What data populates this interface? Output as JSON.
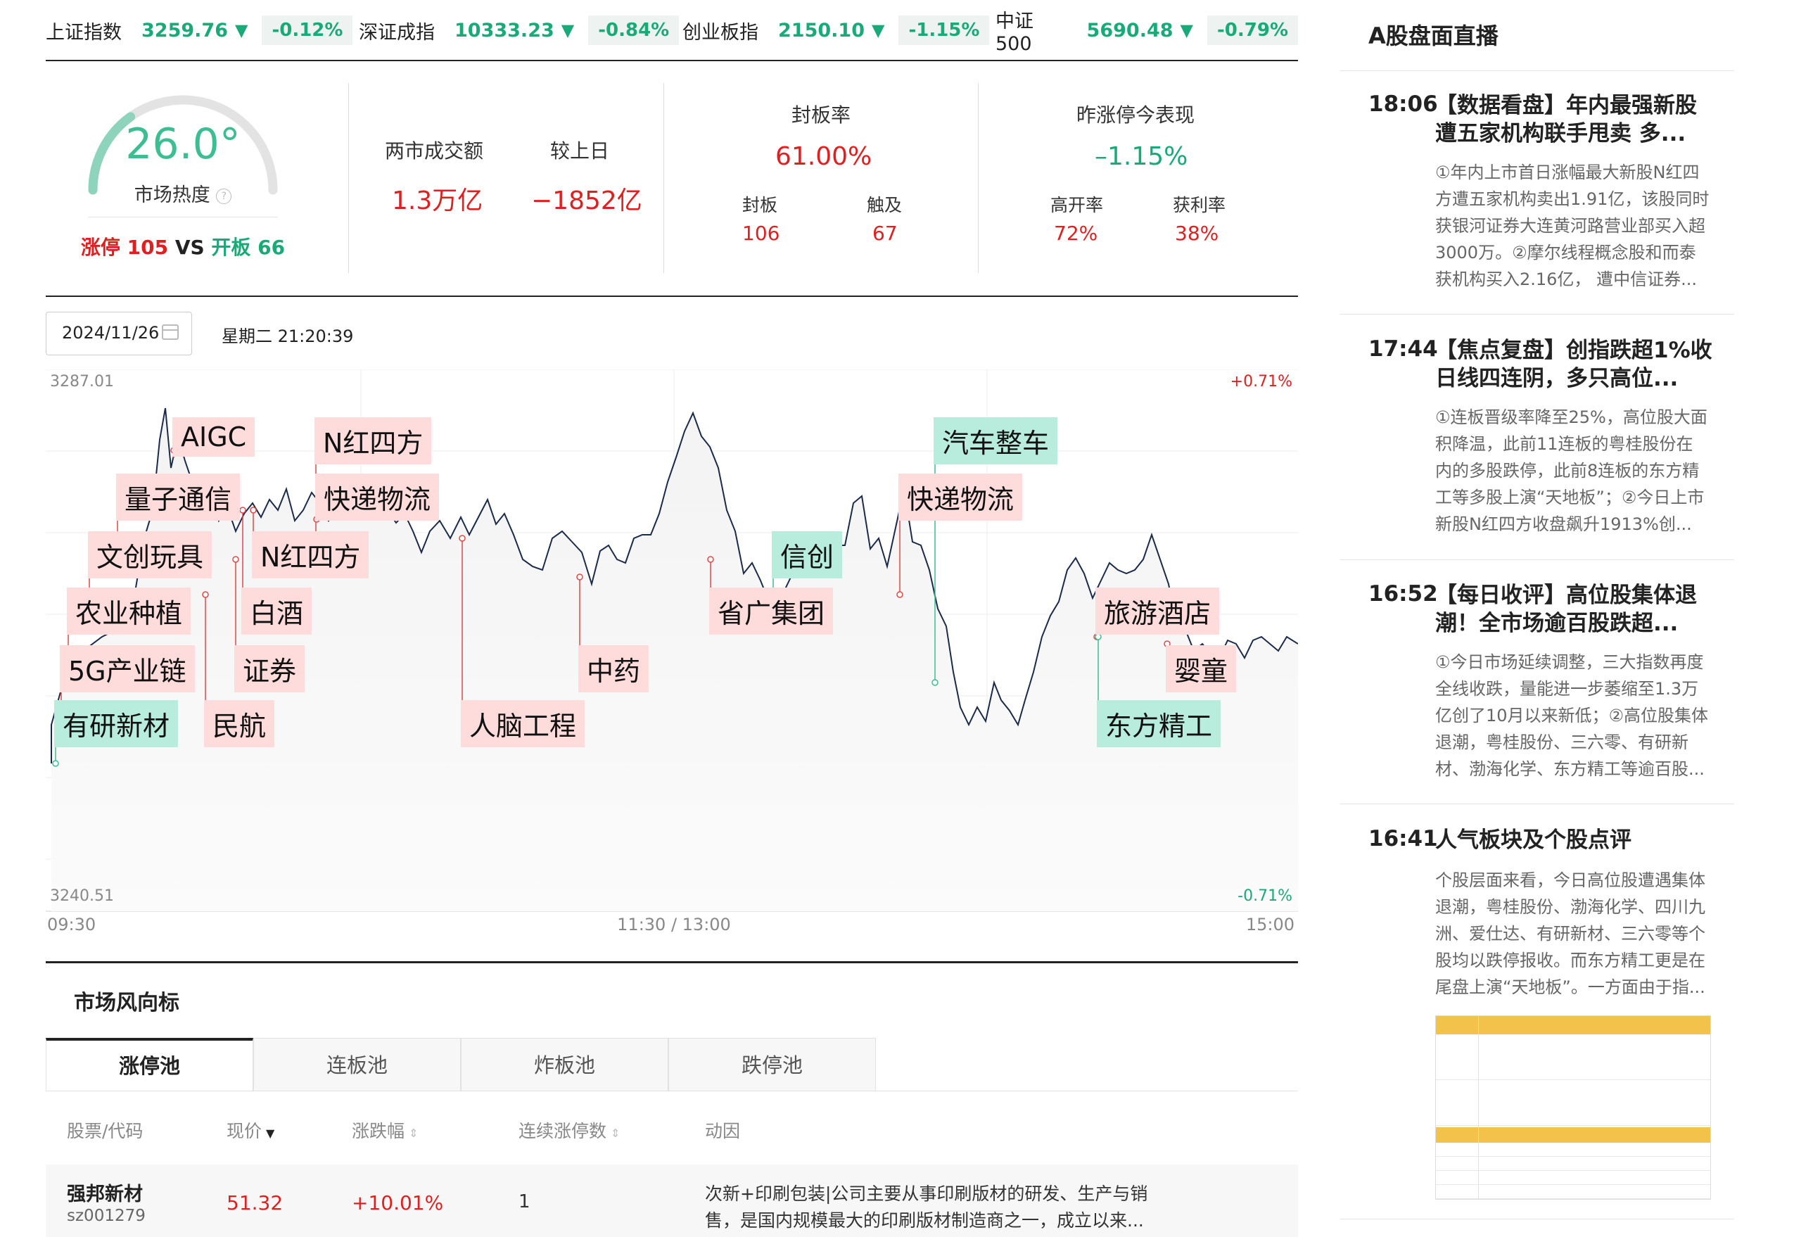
{
  "indices": [
    {
      "name": "上证指数",
      "value": "3259.76",
      "change": "-0.12%"
    },
    {
      "name": "深证成指",
      "value": "10333.23",
      "change": "-0.84%"
    },
    {
      "name": "创业板指",
      "value": "2150.10",
      "change": "-1.15%"
    },
    {
      "name": "中证500",
      "value": "5690.48",
      "change": "-0.79%"
    }
  ],
  "heat": {
    "value": "26.0°",
    "level": 0.26,
    "label": "市场热度",
    "limit_up_label": "涨停",
    "limit_up_count": "105",
    "vs": "VS",
    "open_label": "开板",
    "open_count": "66"
  },
  "turnover": {
    "total_label": "两市成交额",
    "total_value": "1.3万亿",
    "diff_label": "较上日",
    "diff_value": "−1852亿"
  },
  "seal": {
    "title": "封板率",
    "rate": "61.00%",
    "sealed_label": "封板",
    "sealed_value": "106",
    "touched_label": "触及",
    "touched_value": "67"
  },
  "yesterday": {
    "title": "昨涨停今表现",
    "value": "–1.15%",
    "high_open_label": "高开率",
    "high_open_value": "72%",
    "profit_label": "获利率",
    "profit_value": "38%"
  },
  "date": {
    "value": "2024/11/26",
    "weekday_time": "星期二 21:20:39"
  },
  "chart_data": {
    "type": "line",
    "ylim": [
      3240.51,
      3287.01
    ],
    "y_top_label": "3287.01",
    "y_bottom_label": "3240.51",
    "right_top_label": "+0.71%",
    "right_bottom_label": "-0.71%",
    "x_labels": [
      "09:30",
      "11:30 / 13:00",
      "15:00"
    ],
    "tags": [
      {
        "text": "有研新材",
        "color": "green"
      },
      {
        "text": "5G产业链",
        "color": "red"
      },
      {
        "text": "农业种植",
        "color": "red"
      },
      {
        "text": "文创玩具",
        "color": "red"
      },
      {
        "text": "量子通信",
        "color": "red"
      },
      {
        "text": "AIGC",
        "color": "red"
      },
      {
        "text": "民航",
        "color": "red"
      },
      {
        "text": "证券",
        "color": "red"
      },
      {
        "text": "白酒",
        "color": "red"
      },
      {
        "text": "N红四方",
        "color": "red"
      },
      {
        "text": "N红四方",
        "color": "red"
      },
      {
        "text": "快递物流",
        "color": "red"
      },
      {
        "text": "人脑工程",
        "color": "red"
      },
      {
        "text": "中药",
        "color": "red"
      },
      {
        "text": "省广集团",
        "color": "red"
      },
      {
        "text": "信创",
        "color": "green"
      },
      {
        "text": "快递物流",
        "color": "red"
      },
      {
        "text": "汽车整车",
        "color": "green"
      },
      {
        "text": "旅游酒店",
        "color": "red"
      },
      {
        "text": "东方精工",
        "color": "green"
      },
      {
        "text": "婴童",
        "color": "red"
      }
    ]
  },
  "market": {
    "title": "市场风向标",
    "tabs": [
      "涨停池",
      "连板池",
      "炸板池",
      "跌停池"
    ],
    "headers": [
      "股票/代码",
      "现价",
      "涨跌幅",
      "连续涨停数",
      "动因"
    ],
    "rows": [
      {
        "name": "强邦新材",
        "code": "sz001279",
        "price": "51.32",
        "change": "+10.01%",
        "streak": "1",
        "reason_line1": "次新+印刷包装|公司主要从事印刷版材的研发、生产与销",
        "reason_line2": "售，是国内规模最大的印刷版材制造商之一，成立以来..."
      }
    ]
  },
  "live": {
    "title": "A股盘面直播",
    "items": [
      {
        "time": "18:06",
        "title": "【数据看盘】年内最强新股遭五家机构联手甩卖 多...",
        "body": "①年内上市首日涨幅最大新股N红四方遭五家机构卖出1.91亿，该股同时获银河证券大连黄河路营业部买入超3000万。②摩尔线程概念股和而泰获机构买入2.16亿， 遭中信证券..."
      },
      {
        "time": "17:44",
        "title": "【焦点复盘】创指跌超1%收日线四连阴，多只高位...",
        "body": "①连板晋级率降至25%，高位股大面积降温，此前11连板的粤桂股份在内的多股跌停，此前8连板的东方精工等多股上演“天地板”；②今日上市新股N红四方收盘飙升1913%创..."
      },
      {
        "time": "16:52",
        "title": "【每日收评】高位股集体退潮！全市场逾百股跌超...",
        "body": "①今日市场延续调整，三大指数再度全线收跌，量能进一步萎缩至1.3万亿创了10月以来新低；②高位股集体退潮，粤桂股份、三六零、有研新材、渤海化学、东方精工等逾百股..."
      },
      {
        "time": "16:41",
        "title": "人气板块及个股点评",
        "body": "个股层面来看，今日高位股遭遇集体退潮，粤桂股份、渤海化学、四川九洲、爱仕达、有研新材、三六零等个股均以跌停报收。而东方精工更是在尾盘上演“天地板”。一方面由于指..."
      }
    ]
  },
  "colors": {
    "up": "#e02020",
    "down": "#1aaa78",
    "line": "#1a2a4a"
  }
}
